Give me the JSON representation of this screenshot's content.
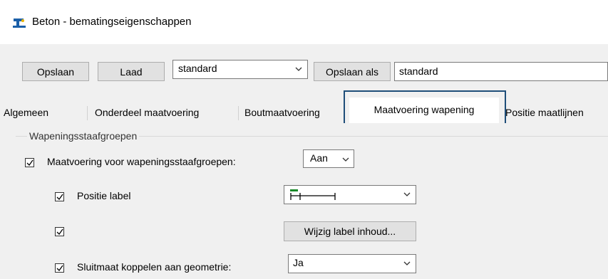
{
  "window": {
    "title": "Beton - bematingseigenschappen",
    "icon": "concrete-beam-icon"
  },
  "toolbar": {
    "save_label": "Opslaan",
    "load_label": "Laad",
    "preset_value": "standard",
    "save_as_label": "Opslaan als",
    "save_as_value": "standard"
  },
  "tabs": [
    {
      "label": "Algemeen"
    },
    {
      "label": "Onderdeel maatvoering"
    },
    {
      "label": "Boutmaatvoering"
    },
    {
      "label": "Maatvoering wapening",
      "active": true
    },
    {
      "label": "Positie maatlijnen"
    }
  ],
  "group": {
    "title": "Wapeningsstaafgroepen",
    "main_option": {
      "label": "Maatvoering voor wapeningsstaafgroepen:",
      "checked": true,
      "value": "Aan"
    },
    "position_label": {
      "label": "Positie label",
      "checked": true,
      "value_icon": "dimension-line-icon"
    },
    "label_content": {
      "checked": true,
      "button_label": "Wijzig label inhoud..."
    },
    "closing_dim": {
      "label": "Sluitmaat koppelen aan geometrie:",
      "checked": true,
      "value": "Ja"
    }
  },
  "colors": {
    "highlight": "#1f4e79",
    "accent_green": "#1a8a2a"
  }
}
